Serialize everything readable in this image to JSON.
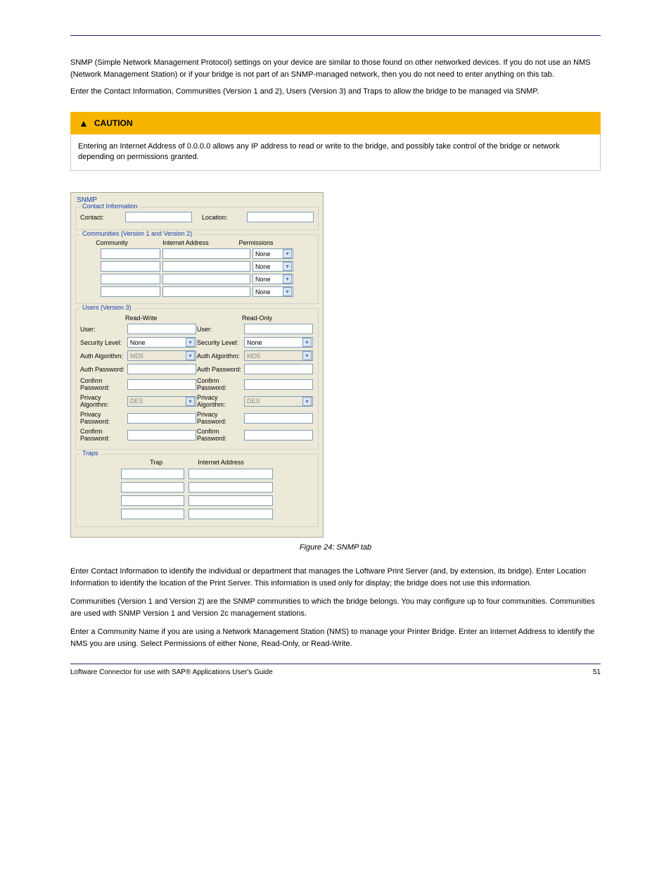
{
  "intro": {
    "p1": "SNMP (Simple Network Management Protocol) settings on your device are similar to those found on other networked devices. If you do not use an NMS (Network Management Station) or if your bridge is not part of an SNMP-managed network, then you do not need to enter anything on this tab.",
    "p2": "Enter the Contact Information, Communities (Version 1 and 2), Users (Version 3) and Traps to allow the bridge to be managed via SNMP."
  },
  "caution": {
    "heading": "CAUTION",
    "text": "Entering an Internet Address of 0.0.0.0 allows any IP address to read or write to the bridge, and possibly take control of the bridge or network depending on permissions granted."
  },
  "panel": {
    "title": "SNMP",
    "contact": {
      "legend": "Contact Information",
      "contact_label": "Contact:",
      "location_label": "Location:"
    },
    "communities": {
      "legend": "Communities (Version 1 and Version 2)",
      "col1": "Community",
      "col2": "Internet Address",
      "col3": "Permissions",
      "perm_default": "None"
    },
    "users": {
      "legend": "Users (Version 3)",
      "rw_heading": "Read-Write",
      "ro_heading": "Read-Only",
      "user_label": "User:",
      "security_label": "Security Level:",
      "authalg_label": "Auth Algorithm:",
      "authpw_label": "Auth Password:",
      "confirmpw_label": "Confirm Password:",
      "privalg_label": "Privacy Algorithm:",
      "privpw_label": "Privacy Password:",
      "none": "None",
      "md5": "MD5",
      "des": "DES"
    },
    "traps": {
      "legend": "Traps",
      "col1": "Trap",
      "col2": "Internet Address"
    }
  },
  "figure_caption": "Figure 24: SNMP tab",
  "body": {
    "p1": "Enter Contact Information to identify the individual or department that manages the Loftware Print Server (and, by extension, its bridge). Enter Location Information to identify the location of the Print Server. This information is used only for display; the bridge does not use this information.",
    "p2": "Communities (Version 1 and Version 2) are the SNMP communities to which the bridge belongs. You may configure up to four communities. Communities are used with SNMP Version 1 and Version 2c management stations.",
    "p3": "Enter a Community Name if you are using a Network Management Station (NMS) to manage your Printer Bridge. Enter an Internet Address to identify the NMS you are using. Select Permissions of either None, Read-Only, or Read-Write."
  },
  "footer": {
    "left": "Loftware Connector for use with SAP® Applications User's Guide",
    "right": "51"
  }
}
